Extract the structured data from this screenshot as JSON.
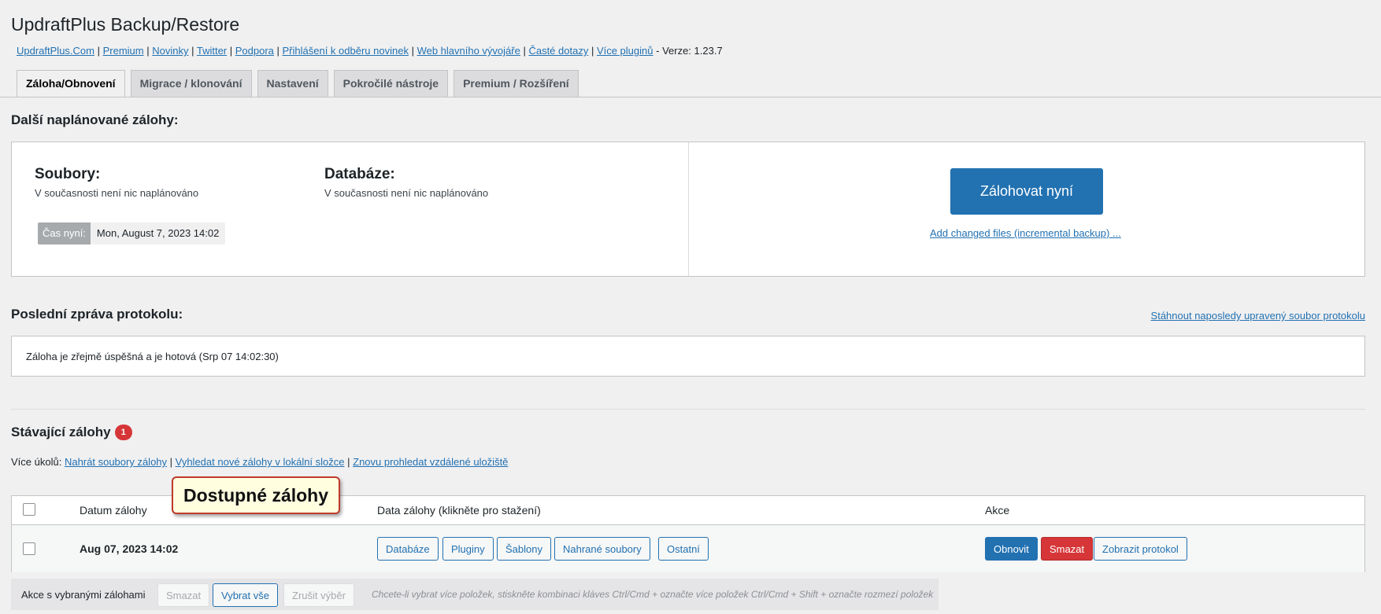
{
  "page_title": "UpdraftPlus Backup/Restore",
  "links": [
    "UpdraftPlus.Com",
    "Premium",
    "Novinky",
    "Twitter",
    "Podpora",
    "Přihlášení k odběru novinek",
    "Web hlavního vývojáře",
    "Časté dotazy",
    "Více pluginů"
  ],
  "version_text": "- Verze: 1.23.7",
  "tabs": [
    "Záloha/Obnovení",
    "Migrace / klonování",
    "Nastavení",
    "Pokročilé nástroje",
    "Premium / Rozšíření"
  ],
  "scheduled": {
    "heading": "Další naplánované zálohy:",
    "files_title": "Soubory:",
    "files_text": "V současnosti není nic naplánováno",
    "db_title": "Databáze:",
    "db_text": "V současnosti není nic naplánováno",
    "time_label": "Čas nyní:",
    "time_value": "Mon, August 7, 2023 14:02",
    "backup_now": "Zálohovat nyní",
    "incremental_link": "Add changed files (incremental backup) ..."
  },
  "log": {
    "heading": "Poslední zpráva protokolu:",
    "download_link": "Stáhnout naposledy upravený soubor protokolu",
    "message": "Záloha je zřejmě úspěšná a je hotová (Srp 07 14:02:30)"
  },
  "existing": {
    "heading": "Stávající zálohy",
    "count": "1",
    "more_tasks_label": "Více úkolů:",
    "task_links": [
      "Nahrát soubory zálohy",
      "Vyhledat nové zálohy v lokální složce",
      "Znovu prohledat vzdálené uložiště"
    ]
  },
  "callout": "Dostupné zálohy",
  "table": {
    "col_date": "Datum zálohy",
    "col_data": "Data zálohy (klikněte pro stažení)",
    "col_actions": "Akce",
    "row": {
      "date": "Aug 07, 2023 14:02",
      "data_buttons": [
        "Databáze",
        "Pluginy",
        "Šablony",
        "Nahrané soubory",
        "Ostatní"
      ],
      "restore": "Obnovit",
      "delete": "Smazat",
      "view_log": "Zobrazit protokol"
    }
  },
  "bulk": {
    "label": "Akce s vybranými zálohami",
    "delete": "Smazat",
    "select_all": "Vybrat vše",
    "deselect": "Zrušit výběr",
    "hint": "Chcete-li vybrat více položek, stiskněte kombinaci kláves Ctrl/Cmd + označte více položek Ctrl/Cmd + Shift + označte rozmezí položek"
  },
  "colors": {
    "primary": "#2271b1",
    "danger": "#d63638",
    "callout_bg": "#ffffe0",
    "callout_border": "#c0392b"
  }
}
